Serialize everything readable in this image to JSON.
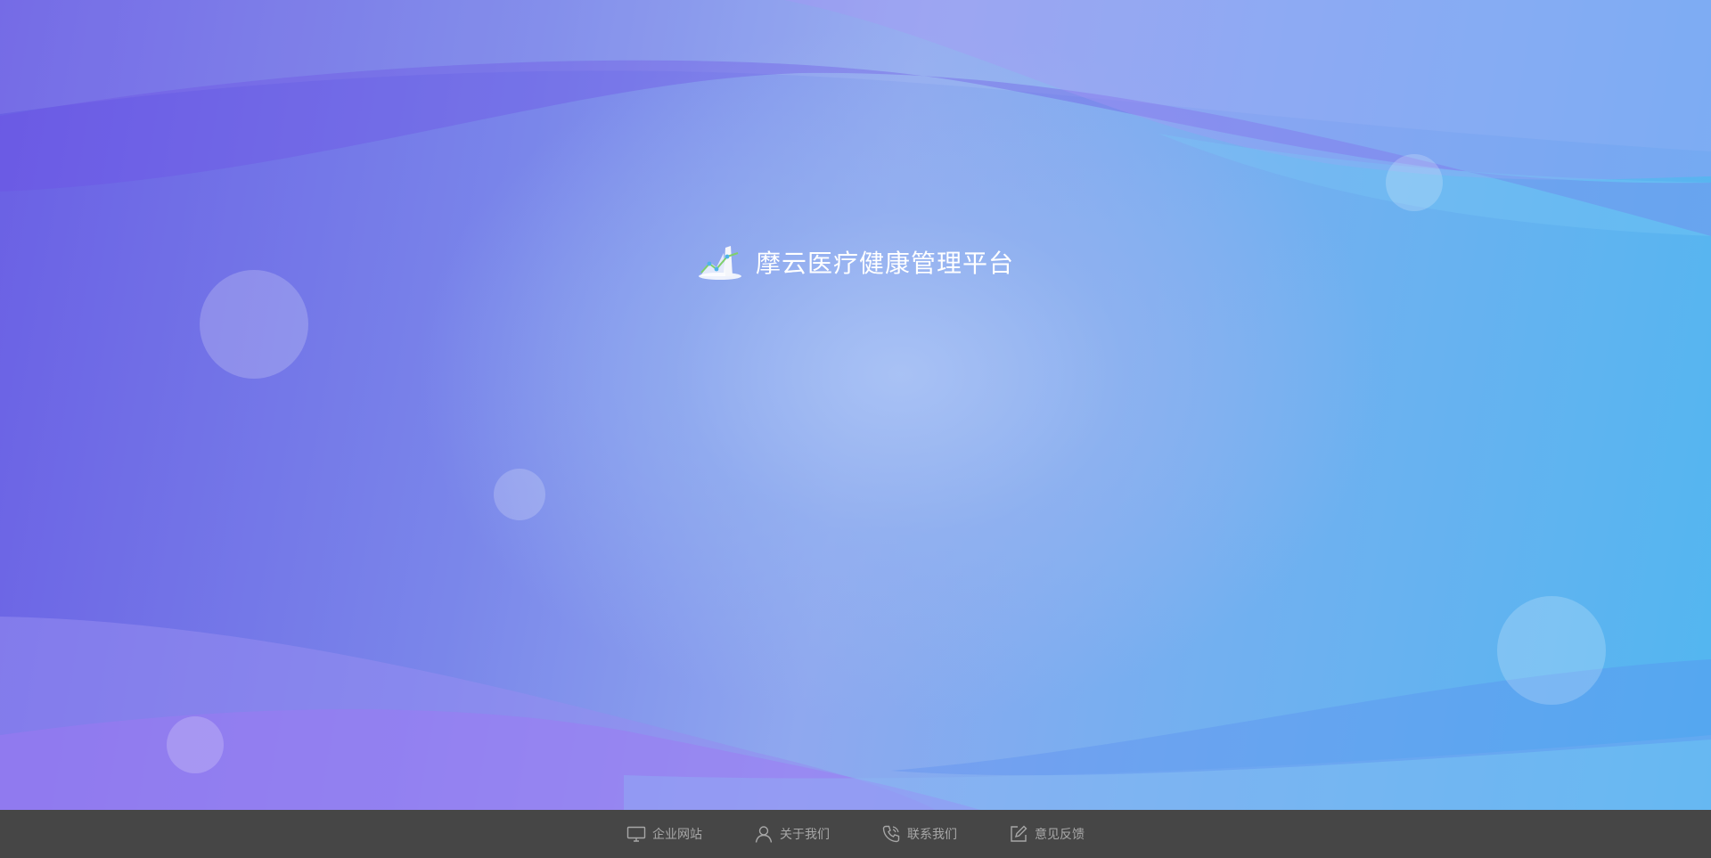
{
  "app": {
    "title": "摩云医疗健康管理平台"
  },
  "footer": {
    "links": [
      {
        "label": "企业网站",
        "icon": "monitor-icon"
      },
      {
        "label": "关于我们",
        "icon": "user-icon"
      },
      {
        "label": "联系我们",
        "icon": "phone-icon"
      },
      {
        "label": "意见反馈",
        "icon": "edit-icon"
      }
    ]
  },
  "colors": {
    "footer_bg": "#464646",
    "footer_text": "#a7a7a7",
    "title_text": "#ffffff"
  }
}
